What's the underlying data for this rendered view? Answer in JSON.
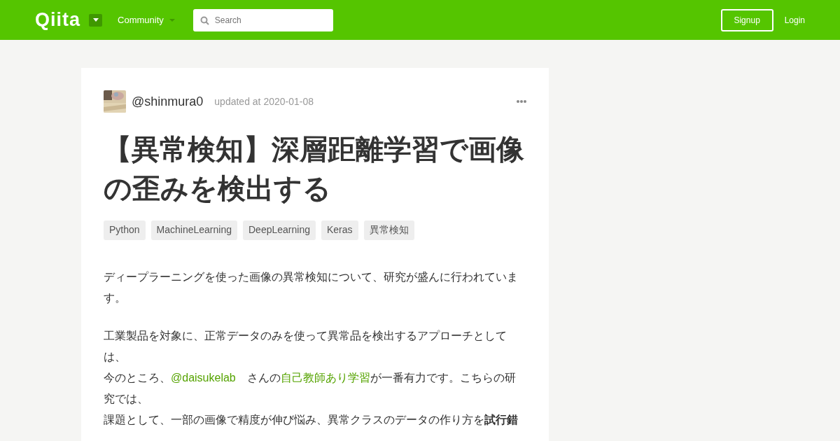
{
  "header": {
    "logo": "Qiita",
    "community": "Community",
    "search": {
      "placeholder": "Search"
    },
    "signup": "Signup",
    "login": "Login"
  },
  "article": {
    "author": "@shinmura0",
    "updated": "updated at 2020-01-08",
    "title": "【異常検知】深層距離学習で画像の歪みを検出する",
    "tags": [
      "Python",
      "MachineLearning",
      "DeepLearning",
      "Keras",
      "異常検知"
    ],
    "paragraphs": [
      [
        [
          {
            "kind": "text",
            "text": "ディープラーニングを使った画像の異常検知について、研究が盛んに行われています。"
          }
        ]
      ],
      [
        [
          {
            "kind": "text",
            "text": "工業製品を対象に、正常データのみを使って異常品を検出するアプローチとしては、"
          }
        ],
        [
          {
            "kind": "text",
            "text": "今のところ、"
          },
          {
            "kind": "link",
            "text": "@daisukelab"
          },
          {
            "kind": "text",
            "text": "　さんの"
          },
          {
            "kind": "link",
            "text": "自己教師あり学習"
          },
          {
            "kind": "text",
            "text": "が一番有力です。こちらの研究では、"
          }
        ],
        [
          {
            "kind": "text",
            "text": "課題として、一部の画像で精度が伸び悩み、異常クラスのデータの作り方を**試行錯**"
          }
        ]
      ]
    ]
  }
}
